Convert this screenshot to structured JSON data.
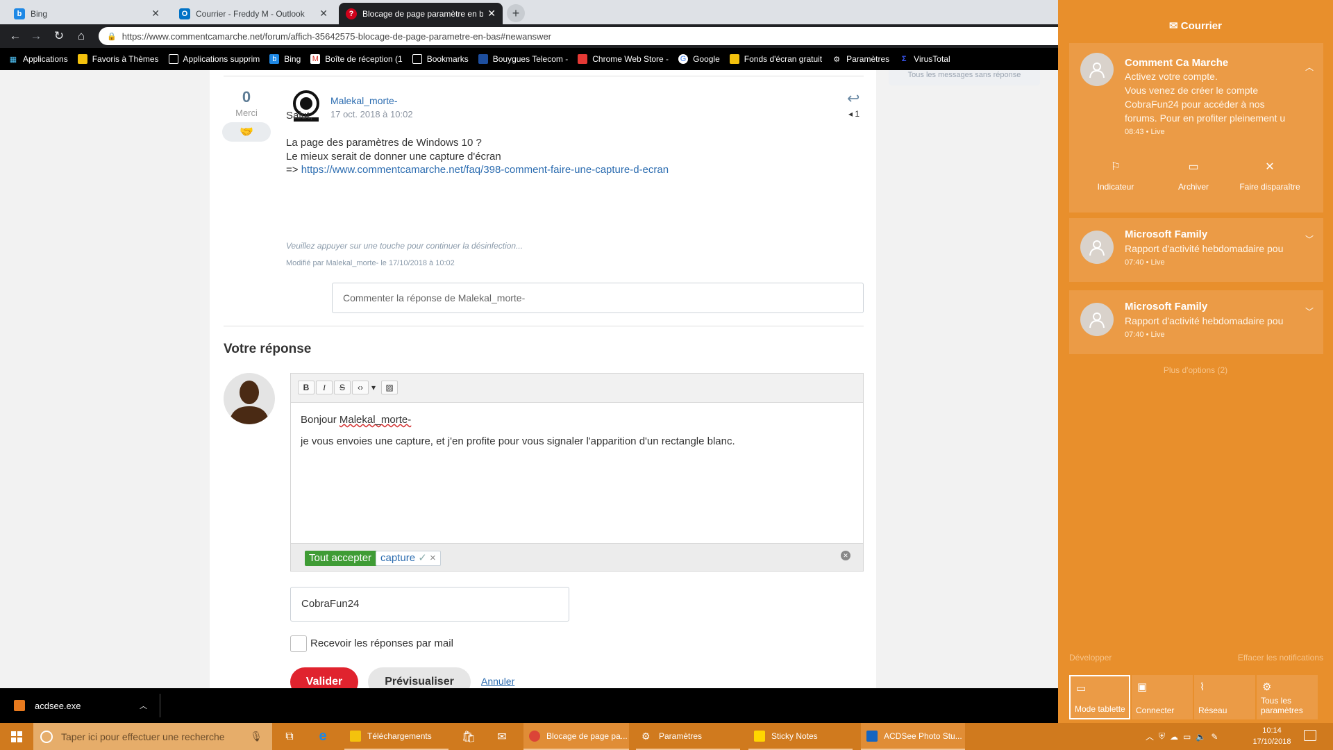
{
  "browser": {
    "tabs": [
      {
        "label": "Bing",
        "color": "#1e88e5",
        "glyph": "b"
      },
      {
        "label": "Courrier - Freddy M - Outlook",
        "color": "#0072c6",
        "glyph": "O"
      },
      {
        "label": "Blocage de page paramètre en b",
        "color": "#d0021b",
        "glyph": "?"
      }
    ],
    "url": "https://www.commentcamarche.net/forum/affich-35642575-blocage-de-page-parametre-en-bas#newanswer",
    "bookmarks": [
      {
        "label": "Applications",
        "icon": "apps-grid-icon"
      },
      {
        "label": "Favoris à Thèmes",
        "icon": "folder-icon"
      },
      {
        "label": "Applications supprim",
        "icon": "page-icon"
      },
      {
        "label": "Bing",
        "icon": "bing-icon"
      },
      {
        "label": "Boîte de réception (1",
        "icon": "gmail-icon"
      },
      {
        "label": "Bookmarks",
        "icon": "page-icon"
      },
      {
        "label": "Bouygues Telecom -",
        "icon": "bouygues-icon"
      },
      {
        "label": "Chrome Web Store -",
        "icon": "webstore-icon"
      },
      {
        "label": "Google",
        "icon": "google-icon"
      },
      {
        "label": "Fonds d'écran gratuit",
        "icon": "wallpaper-icon"
      },
      {
        "label": "Paramètres",
        "icon": "gear-icon"
      },
      {
        "label": "VirusTotal",
        "icon": "virustotal-icon"
      }
    ]
  },
  "post": {
    "votes": "0",
    "votes_label": "Merci",
    "author": "Malekal_morte-",
    "date": "17 oct. 2018 à 10:02",
    "reply_count": "1",
    "lines": [
      "Salut,",
      "La page des paramètres de Windows 10 ?",
      "Le mieux serait de donner une capture d'écran"
    ],
    "link_prefix": "=> ",
    "link": "https://www.commentcamarche.net/faq/398-comment-faire-une-capture-d-ecran",
    "signature": "Veuillez appuyer sur une touche pour continuer la désinfection...",
    "modified": "Modifié par Malekal_morte- le 17/10/2018 à 10:02",
    "comment_placeholder": "Commenter la réponse de Malekal_morte-"
  },
  "sidebar_link": "Tous les messages sans réponse",
  "reply": {
    "heading": "Votre réponse",
    "toolbar": {
      "bold": "B",
      "italic": "I",
      "strike": "S",
      "code": "‹›",
      "dropdown": "▾",
      "image": "🖼"
    },
    "greeting_prefix": "Bonjour ",
    "greeting_name": "Malekal_morte-",
    "body": "je vous envoies une capture, et j'en profite pour vous signaler l'apparition d'un rectangle blanc.",
    "tag_accept": "Tout accepter ✓",
    "tag_capture": "capture",
    "tag_capture_check": "✓",
    "tag_capture_remove": "×",
    "username": "CobraFun24",
    "mail_label": "Recevoir les réponses par mail",
    "submit": "Valider",
    "preview": "Prévisualiser",
    "cancel": "Annuler"
  },
  "download": {
    "file": "acdsee.exe"
  },
  "action_center": {
    "title": "Courrier",
    "notifications": [
      {
        "title": "Comment Ca Marche",
        "body": [
          "Activez votre compte.",
          "Vous venez de créer le compte",
          "CobraFun24 pour accéder à nos",
          "forums. Pour en profiter pleinement u"
        ],
        "meta": "08:43 • Live"
      },
      {
        "title": "Microsoft Family",
        "body": [
          "Rapport d'activité hebdomadaire pou"
        ],
        "meta": "07:40 • Live"
      },
      {
        "title": "Microsoft Family",
        "body": [
          "Rapport d'activité hebdomadaire pou"
        ],
        "meta": "07:40 • Live"
      }
    ],
    "actions": [
      "Indicateur",
      "Archiver",
      "Faire disparaître"
    ],
    "more": "Plus d'options (2)",
    "expand": "Développer",
    "clear": "Effacer les notifications",
    "quick": [
      "Mode tablette",
      "Connecter",
      "Réseau",
      "Tous les paramètres"
    ]
  },
  "taskbar": {
    "search_placeholder": "Taper ici pour effectuer une recherche",
    "apps": [
      "Téléchargements",
      "Blocage de page pa...",
      "Paramètres",
      "Sticky Notes",
      "ACDSee Photo Stu..."
    ],
    "time": "10:14",
    "date": "17/10/2018"
  },
  "colors": {
    "accent": "#e88f2c",
    "taskbar": "#d07a1e",
    "validate": "#e0232e",
    "tag_green": "#3f9c35",
    "link": "#2b6cb0"
  }
}
